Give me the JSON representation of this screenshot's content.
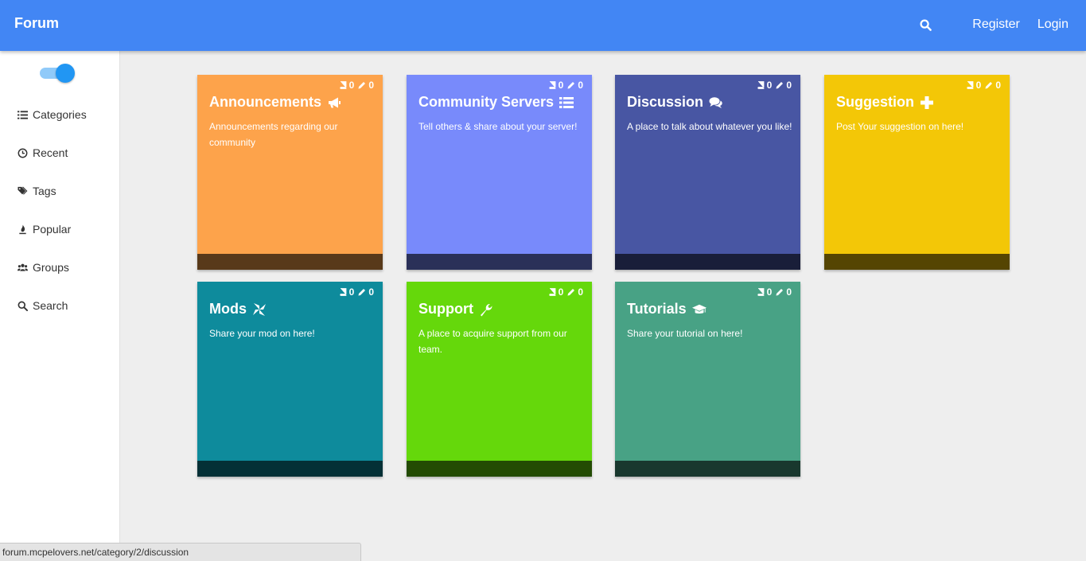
{
  "header": {
    "brand": "Forum",
    "search_icon": "search-icon",
    "register_label": "Register",
    "login_label": "Login",
    "background": "#4286f4"
  },
  "sidebar": {
    "toggle_on": true,
    "items": [
      {
        "label": "Categories",
        "icon": "list-icon"
      },
      {
        "label": "Recent",
        "icon": "clock-icon"
      },
      {
        "label": "Tags",
        "icon": "tags-icon"
      },
      {
        "label": "Popular",
        "icon": "fire-icon"
      },
      {
        "label": "Groups",
        "icon": "users-icon"
      },
      {
        "label": "Search",
        "icon": "search-icon"
      }
    ]
  },
  "categories": [
    {
      "title": "Announcements",
      "icon": "bullhorn-icon",
      "topics": "0",
      "posts": "0",
      "description": "Announcements regarding our community",
      "color": "#fda34b"
    },
    {
      "title": "Community Servers",
      "icon": "list-icon",
      "topics": "0",
      "posts": "0",
      "description": "Tell others & share about your server!",
      "color": "#788afb"
    },
    {
      "title": "Discussion",
      "icon": "comments-icon",
      "topics": "0",
      "posts": "0",
      "description": "A place to talk about whatever you like!",
      "color": "#4856a3"
    },
    {
      "title": "Suggestion",
      "icon": "plus-icon",
      "topics": "0",
      "posts": "0",
      "description": "Post Your suggestion on here!",
      "color": "#f3c707"
    },
    {
      "title": "Mods",
      "icon": "pinwheel-icon",
      "topics": "0",
      "posts": "0",
      "description": "Share your mod on here!",
      "color": "#0e8b9c"
    },
    {
      "title": "Support",
      "icon": "wrench-icon",
      "topics": "0",
      "posts": "0",
      "description": "A place to acquire support from our team.",
      "color": "#65d80b"
    },
    {
      "title": "Tutorials",
      "icon": "graduation-cap-icon",
      "topics": "0",
      "posts": "0",
      "description": "Share your tutorial on here!",
      "color": "#48a285"
    }
  ],
  "status_bar": {
    "url": "forum.mcpelovers.net/category/2/discussion"
  }
}
